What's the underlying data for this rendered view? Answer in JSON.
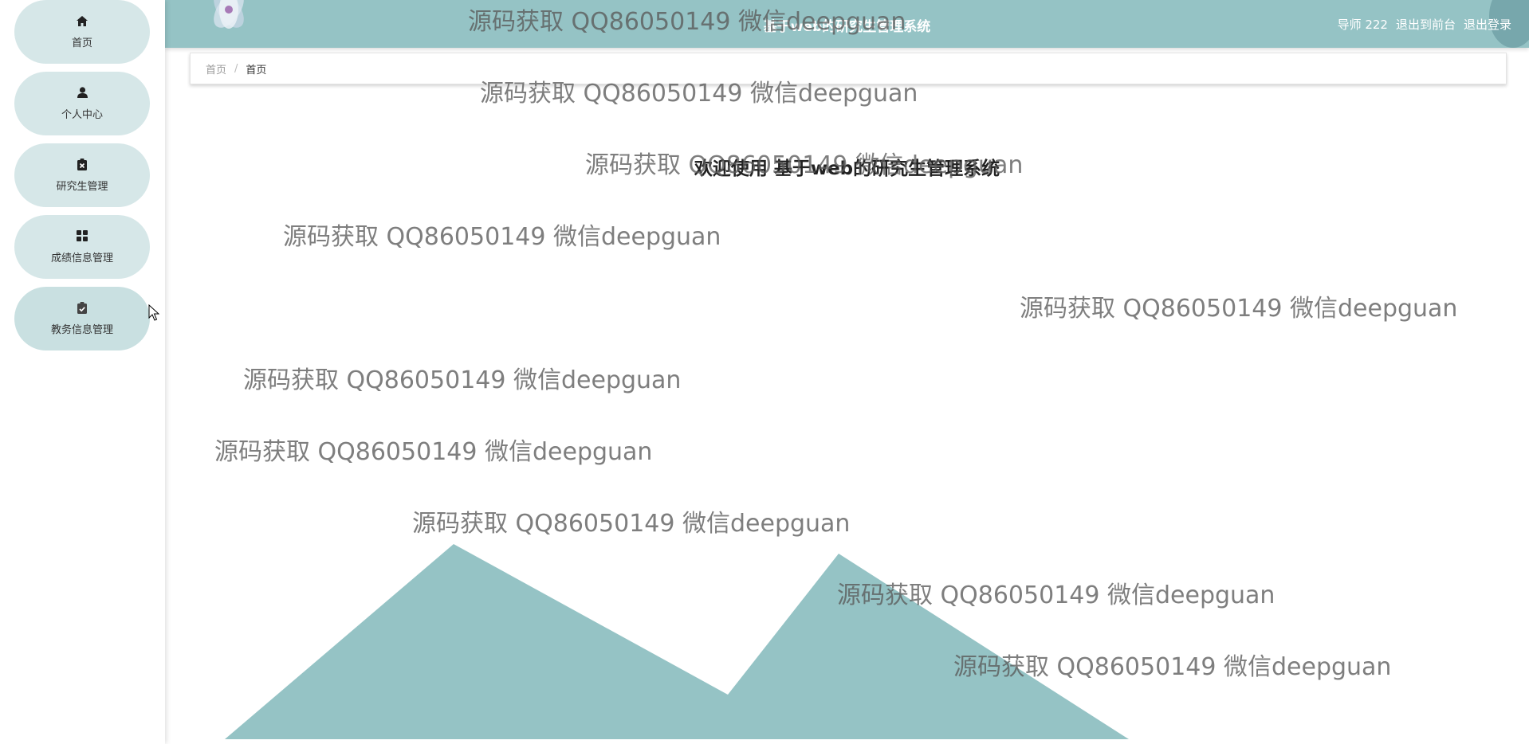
{
  "app": {
    "title": "基于web的研究生管理系统"
  },
  "sidebar": {
    "items": [
      {
        "label": "首页",
        "icon": "home-icon"
      },
      {
        "label": "个人中心",
        "icon": "user-icon"
      },
      {
        "label": "研究生管理",
        "icon": "clipboard-x-icon"
      },
      {
        "label": "成绩信息管理",
        "icon": "grid-icon"
      },
      {
        "label": "教务信息管理",
        "icon": "clipboard-check-icon"
      }
    ]
  },
  "header": {
    "title": "基于web的研究生管理系统",
    "user": "导师 222",
    "to_front": "退出到前台",
    "logout": "退出登录"
  },
  "breadcrumb": {
    "home": "首页",
    "separator": "/",
    "current": "首页"
  },
  "main": {
    "welcome": "欢迎使用 基于web的研究生管理系统"
  },
  "watermark": {
    "text": "源码获取 QQ86050149 微信deepguan"
  },
  "colors": {
    "accent": "#95c3c5",
    "menu_bg": "#d6e7e8"
  }
}
